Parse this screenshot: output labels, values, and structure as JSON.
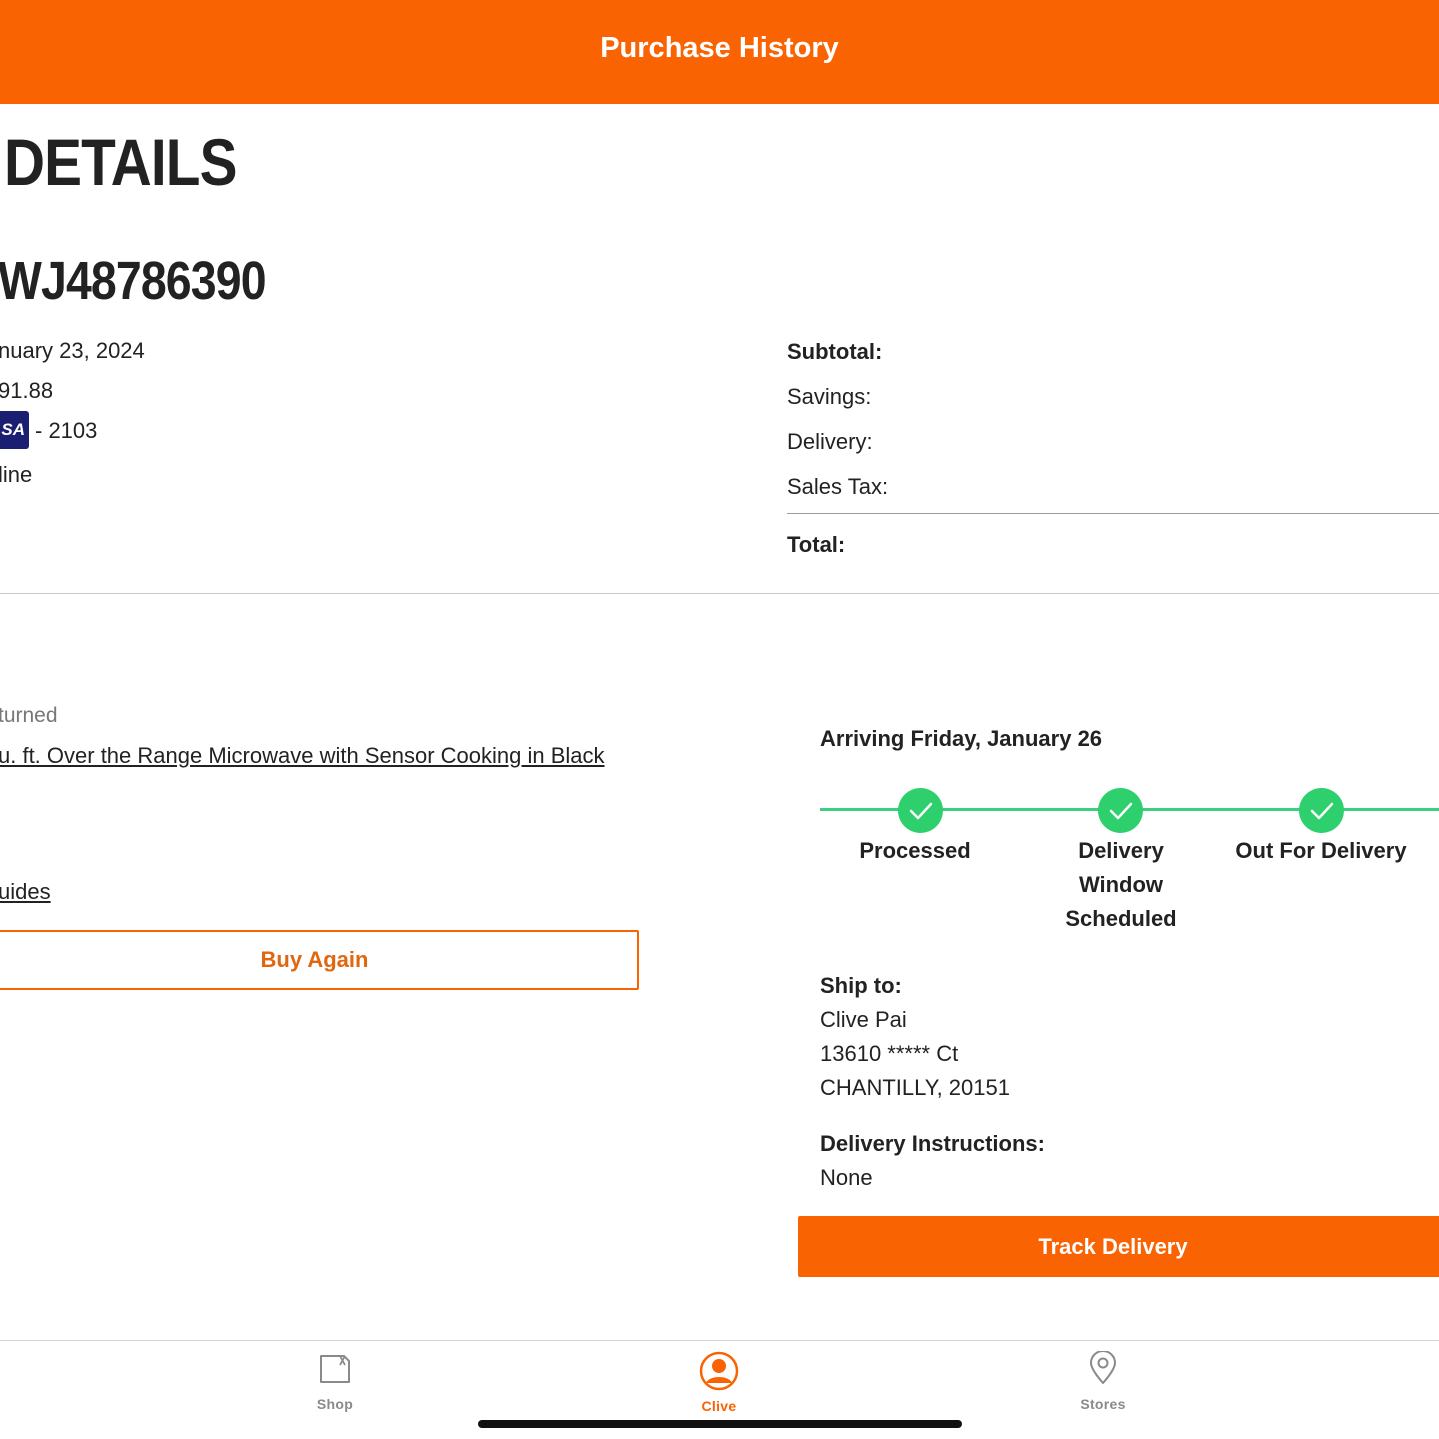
{
  "header": {
    "title": "Purchase History"
  },
  "details": {
    "heading": "DETAILS",
    "order_number": "WJ48786390",
    "order_date": "nuary 23, 2024",
    "order_total": "91.88",
    "payment_brand": "SA",
    "payment_last4": "- 2103",
    "channel": "line"
  },
  "summary": {
    "subtotal_label": "Subtotal:",
    "savings_label": "Savings:",
    "delivery_label": "Delivery:",
    "sales_tax_label": "Sales Tax:",
    "total_label": "Total:"
  },
  "item": {
    "status": "turned",
    "product_name": "u. ft. Over the Range Microwave with Sensor Cooking in Black",
    "guides_link": "uides",
    "buy_again_label": "Buy Again"
  },
  "delivery": {
    "arriving": "Arriving Friday, January 26",
    "steps": [
      {
        "label": "Processed",
        "completed": true
      },
      {
        "label": "Delivery Window Scheduled",
        "completed": true
      },
      {
        "label": "Out For Delivery",
        "completed": true
      }
    ],
    "ship_to_label": "Ship to:",
    "ship_name": "Clive Pai",
    "ship_street": "13610 ***** Ct",
    "ship_city": "CHANTILLY, 20151",
    "instructions_label": "Delivery Instructions:",
    "instructions_value": "None",
    "track_button_label": "Track Delivery"
  },
  "tabbar": {
    "tabs": [
      {
        "label": "Shop",
        "icon": "shop-icon",
        "active": false
      },
      {
        "label": "Clive",
        "icon": "account-icon",
        "active": true
      },
      {
        "label": "Stores",
        "icon": "location-pin-icon",
        "active": false
      }
    ]
  },
  "colors": {
    "brand": "#f96302",
    "success": "#2ed06e",
    "inactive_tab": "#8a8a8a"
  }
}
